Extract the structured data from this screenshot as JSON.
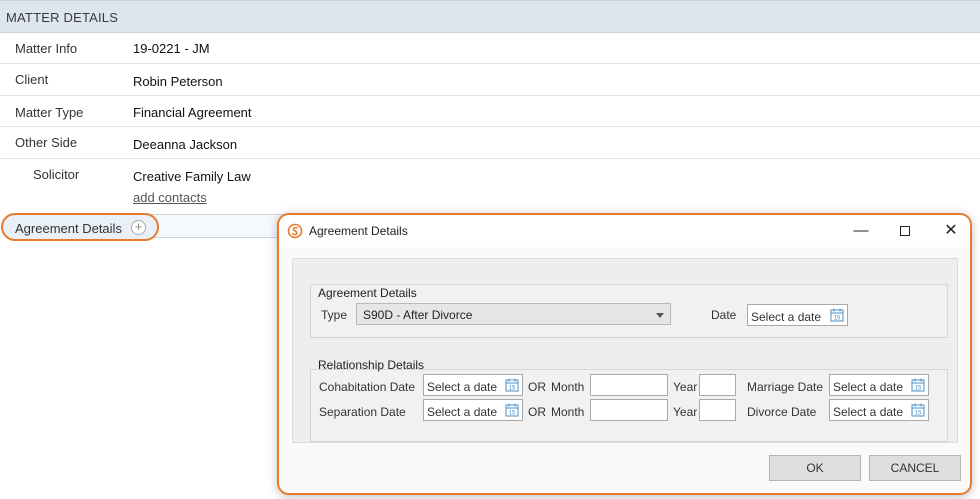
{
  "matter": {
    "header": "MATTER DETAILS",
    "rows": [
      {
        "label": "Matter Info",
        "value": "19-0221 - JM"
      },
      {
        "label": "Client",
        "value": "Robin Peterson"
      },
      {
        "label": "Matter Type",
        "value": "Financial Agreement"
      },
      {
        "label": "Other Side",
        "value": "Deeanna Jackson"
      },
      {
        "label": "Solicitor",
        "value": "Creative Family Law",
        "link": "add contacts"
      }
    ],
    "agreement_label": "Agreement Details",
    "add_icon": "plus-circle-icon"
  },
  "dialog": {
    "title": "Agreement Details",
    "logo_icon": "app-logo-icon",
    "minimize": "—",
    "close": "✕",
    "agreement_group": {
      "title": "Agreement Details",
      "type_label": "Type",
      "type_value": "S90D - After Divorce",
      "date_label": "Date",
      "date_placeholder": "Select a date"
    },
    "relationship_group": {
      "title": "Relationship Details",
      "rows": [
        {
          "label": "Cohabitation Date",
          "date_placeholder": "Select a date",
          "or": "OR",
          "month_label": "Month",
          "month_value": "",
          "year_label": "Year",
          "year_value": "",
          "right_label": "Marriage Date",
          "right_placeholder": "Select a date"
        },
        {
          "label": "Separation Date",
          "date_placeholder": "Select a date",
          "or": "OR",
          "month_label": "Month",
          "month_value": "",
          "year_label": "Year",
          "year_value": "",
          "right_label": "Divorce Date",
          "right_placeholder": "Select a date"
        }
      ]
    },
    "ok_label": "OK",
    "cancel_label": "CANCEL"
  },
  "colors": {
    "accent": "#e87a2e",
    "header_bg": "#dde6ef",
    "calendar_icon": "#4a90c8"
  }
}
